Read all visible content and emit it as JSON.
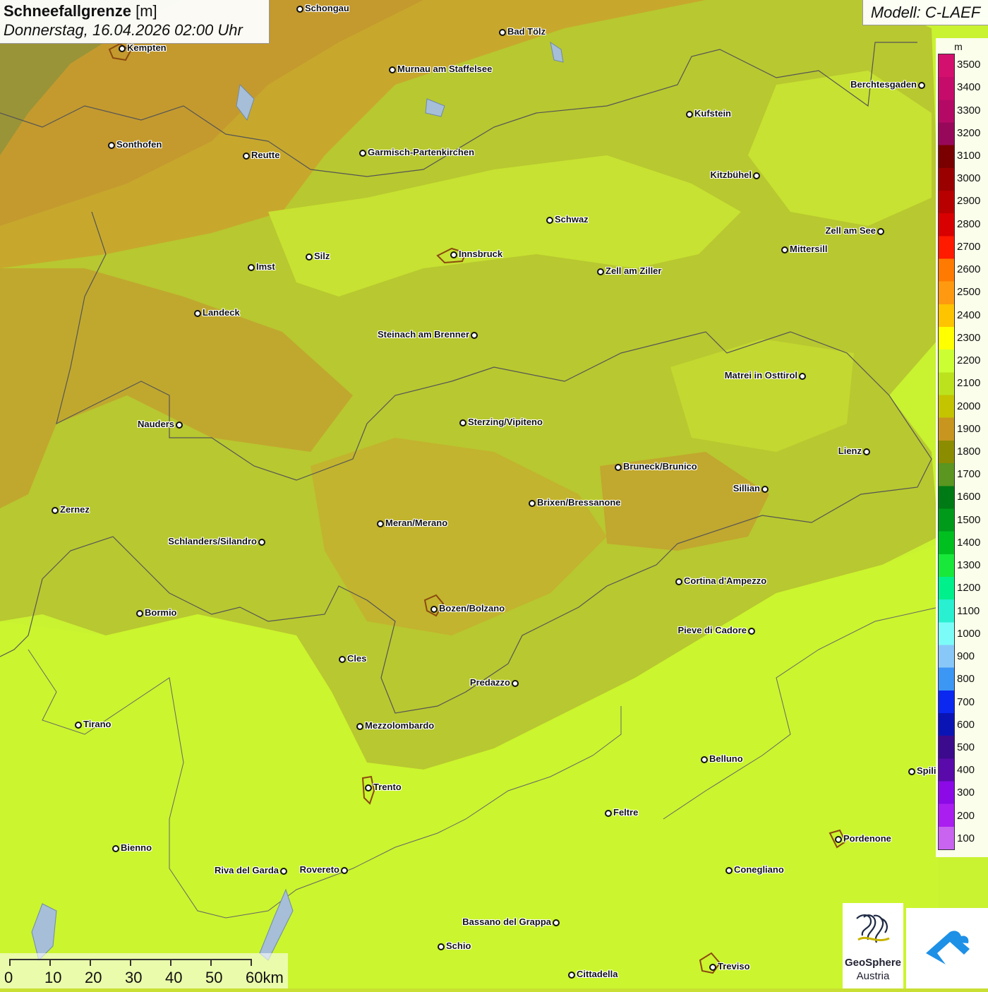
{
  "title": {
    "name": "Schneefallgrenze",
    "unit": "[m]",
    "datetime": "Donnerstag, 16.04.2026 02:00 Uhr"
  },
  "model": "Modell: C-LAEF",
  "legend": {
    "unit": "m",
    "levels": [
      {
        "value": "3500",
        "color": "#d4106e"
      },
      {
        "value": "3400",
        "color": "#c60c6a"
      },
      {
        "value": "3300",
        "color": "#b40a66"
      },
      {
        "value": "3200",
        "color": "#98085a"
      },
      {
        "value": "3100",
        "color": "#7a0000"
      },
      {
        "value": "3000",
        "color": "#9a0000"
      },
      {
        "value": "2900",
        "color": "#b80000"
      },
      {
        "value": "2800",
        "color": "#d80000"
      },
      {
        "value": "2700",
        "color": "#ff1a00"
      },
      {
        "value": "2600",
        "color": "#ff7a00"
      },
      {
        "value": "2500",
        "color": "#ff9a10"
      },
      {
        "value": "2400",
        "color": "#ffc400"
      },
      {
        "value": "2300",
        "color": "#ffff00"
      },
      {
        "value": "2200",
        "color": "#ccff33"
      },
      {
        "value": "2100",
        "color": "#bce21e"
      },
      {
        "value": "2000",
        "color": "#c4c400"
      },
      {
        "value": "1900",
        "color": "#c8961e"
      },
      {
        "value": "1800",
        "color": "#8c8c00"
      },
      {
        "value": "1700",
        "color": "#5a9620"
      },
      {
        "value": "1600",
        "color": "#007a14"
      },
      {
        "value": "1500",
        "color": "#009a1a"
      },
      {
        "value": "1400",
        "color": "#00c020"
      },
      {
        "value": "1300",
        "color": "#18e83a"
      },
      {
        "value": "1200",
        "color": "#00f08c"
      },
      {
        "value": "1100",
        "color": "#28f0d0"
      },
      {
        "value": "1000",
        "color": "#7cfcf8"
      },
      {
        "value": "900",
        "color": "#88c8f8"
      },
      {
        "value": "800",
        "color": "#3c96f4"
      },
      {
        "value": "700",
        "color": "#0a28f0"
      },
      {
        "value": "600",
        "color": "#0a14b4"
      },
      {
        "value": "500",
        "color": "#3c0a8c"
      },
      {
        "value": "400",
        "color": "#5a0aaa"
      },
      {
        "value": "300",
        "color": "#8c0ae6"
      },
      {
        "value": "200",
        "color": "#aa1ef0"
      },
      {
        "value": "100",
        "color": "#c864f0"
      }
    ]
  },
  "cities": [
    {
      "name": "Schongau",
      "side": "right"
    },
    {
      "name": "Bad Tölz",
      "side": "right"
    },
    {
      "name": "Kempten",
      "side": "right"
    },
    {
      "name": "Murnau am Staffelsee",
      "side": "right"
    },
    {
      "name": "Berchtesgaden",
      "side": "left"
    },
    {
      "name": "Kufstein",
      "side": "right"
    },
    {
      "name": "Sonthofen",
      "side": "right"
    },
    {
      "name": "Reutte",
      "side": "right"
    },
    {
      "name": "Garmisch-Partenkirchen",
      "side": "right"
    },
    {
      "name": "Kitzbühel",
      "side": "left"
    },
    {
      "name": "Schwaz",
      "side": "right"
    },
    {
      "name": "Zell am See",
      "side": "left"
    },
    {
      "name": "Mittersill",
      "side": "right"
    },
    {
      "name": "Innsbruck",
      "side": "right"
    },
    {
      "name": "Silz",
      "side": "right"
    },
    {
      "name": "Imst",
      "side": "right"
    },
    {
      "name": "Zell am Ziller",
      "side": "right"
    },
    {
      "name": "Landeck",
      "side": "right"
    },
    {
      "name": "Steinach am Brenner",
      "side": "left"
    },
    {
      "name": "Matrei in Osttirol",
      "side": "left"
    },
    {
      "name": "Nauders",
      "side": "left"
    },
    {
      "name": "Sterzing/Vipiteno",
      "side": "right"
    },
    {
      "name": "Lienz",
      "side": "left"
    },
    {
      "name": "Bruneck/Brunico",
      "side": "right"
    },
    {
      "name": "Sillian",
      "side": "left"
    },
    {
      "name": "Brixen/Bressanone",
      "side": "right"
    },
    {
      "name": "Zernez",
      "side": "right"
    },
    {
      "name": "Meran/Merano",
      "side": "right"
    },
    {
      "name": "Schlanders/Silandro",
      "side": "left"
    },
    {
      "name": "Cortina d'Ampezzo",
      "side": "right"
    },
    {
      "name": "Bozen/Bolzano",
      "side": "right"
    },
    {
      "name": "Bormio",
      "side": "right"
    },
    {
      "name": "Pieve di Cadore",
      "side": "left"
    },
    {
      "name": "Cles",
      "side": "right"
    },
    {
      "name": "Predazzo",
      "side": "left"
    },
    {
      "name": "Tirano",
      "side": "right"
    },
    {
      "name": "Mezzolombardo",
      "side": "right"
    },
    {
      "name": "Belluno",
      "side": "right"
    },
    {
      "name": "Spili",
      "side": "right"
    },
    {
      "name": "Trento",
      "side": "right"
    },
    {
      "name": "Feltre",
      "side": "right"
    },
    {
      "name": "Pordenone",
      "side": "right"
    },
    {
      "name": "Bienno",
      "side": "right"
    },
    {
      "name": "Riva del Garda",
      "side": "left"
    },
    {
      "name": "Rovereto",
      "side": "left"
    },
    {
      "name": "Conegliano",
      "side": "right"
    },
    {
      "name": "Bassano del Grappa",
      "side": "left"
    },
    {
      "name": "Schio",
      "side": "right"
    },
    {
      "name": "Treviso",
      "side": "right"
    },
    {
      "name": "Cittadella",
      "side": "right"
    }
  ],
  "scale": {
    "labels": [
      "0",
      "10",
      "20",
      "30",
      "40",
      "50",
      "60km"
    ]
  },
  "logo": {
    "name_line1": "GeoSphere",
    "name_line2": "Austria"
  }
}
